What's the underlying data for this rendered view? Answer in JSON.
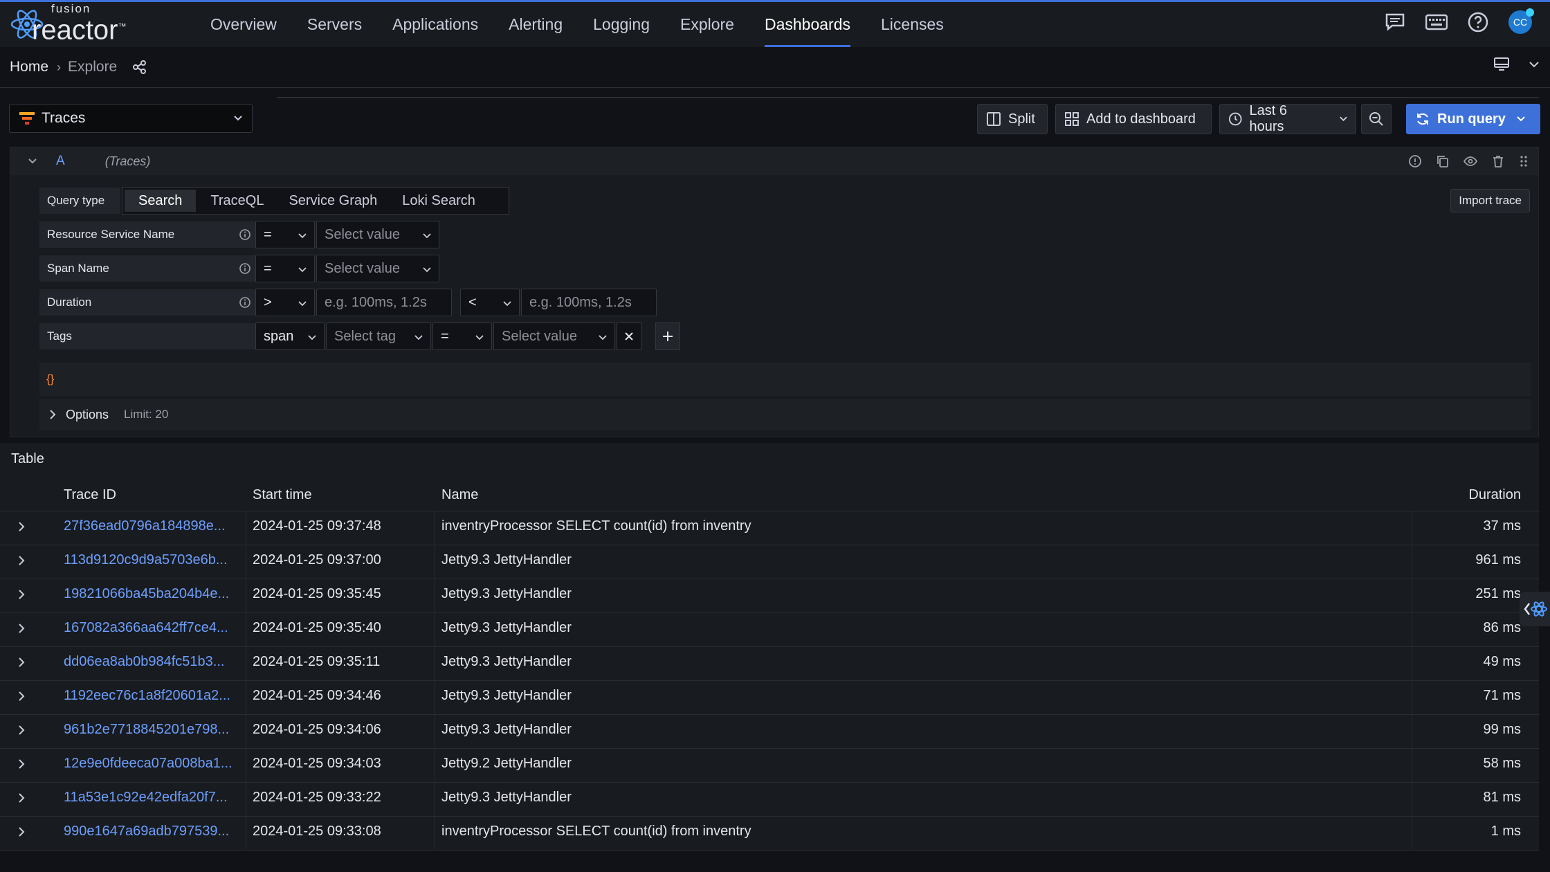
{
  "app": {
    "logo_small": "fusion",
    "logo_big": "reactor",
    "logo_tm": "™"
  },
  "nav": {
    "items": [
      {
        "label": "Overview"
      },
      {
        "label": "Servers"
      },
      {
        "label": "Applications"
      },
      {
        "label": "Alerting"
      },
      {
        "label": "Logging"
      },
      {
        "label": "Explore"
      },
      {
        "label": "Dashboards",
        "active": true
      },
      {
        "label": "Licenses"
      }
    ],
    "icons": [
      "chat-icon",
      "keyboard-icon",
      "help-icon"
    ],
    "avatar_text": "CC"
  },
  "breadcrumb": {
    "home": "Home",
    "current": "Explore"
  },
  "toolbar": {
    "datasource": "Traces",
    "split": "Split",
    "add_to_dashboard": "Add to dashboard",
    "time_range": "Last 6 hours",
    "run_query": "Run query"
  },
  "query": {
    "letter": "A",
    "datasource_label": "(Traces)",
    "query_type_label": "Query type",
    "tabs": [
      "Search",
      "TraceQL",
      "Service Graph",
      "Loki Search"
    ],
    "active_tab": "Search",
    "import_trace": "Import trace",
    "filters": {
      "resource_service_name": {
        "label": "Resource Service Name",
        "operator": "=",
        "value_placeholder": "Select value"
      },
      "span_name": {
        "label": "Span Name",
        "operator": "=",
        "value_placeholder": "Select value"
      },
      "duration": {
        "label": "Duration",
        "op_min": ">",
        "min_placeholder": "e.g. 100ms, 1.2s",
        "op_max": "<",
        "max_placeholder": "e.g. 100ms, 1.2s"
      },
      "tags": {
        "label": "Tags",
        "scope": "span",
        "tag_placeholder": "Select tag",
        "operator": "=",
        "value_placeholder": "Select value"
      }
    },
    "editor_text": "{}",
    "options_label": "Options",
    "options_limit": "Limit: 20"
  },
  "table": {
    "title": "Table",
    "columns": [
      "Trace ID",
      "Start time",
      "Name",
      "Duration"
    ],
    "rows": [
      {
        "trace_id": "27f36ead0796a184898e...",
        "start": "2024-01-25 09:37:48",
        "name": "inventryProcessor SELECT count(id) from inventry",
        "duration": "37 ms"
      },
      {
        "trace_id": "113d9120c9d9a5703e6b...",
        "start": "2024-01-25 09:37:00",
        "name": "Jetty9.3 JettyHandler",
        "duration": "961 ms"
      },
      {
        "trace_id": "19821066ba45ba204b4e...",
        "start": "2024-01-25 09:35:45",
        "name": "Jetty9.3 JettyHandler",
        "duration": "251 ms"
      },
      {
        "trace_id": "167082a366aa642ff7ce4...",
        "start": "2024-01-25 09:35:40",
        "name": "Jetty9.3 JettyHandler",
        "duration": "86 ms"
      },
      {
        "trace_id": "dd06ea8ab0b984fc51b3...",
        "start": "2024-01-25 09:35:11",
        "name": "Jetty9.3 JettyHandler",
        "duration": "49 ms"
      },
      {
        "trace_id": "1192eec76c1a8f20601a2...",
        "start": "2024-01-25 09:34:46",
        "name": "Jetty9.3 JettyHandler",
        "duration": "71 ms"
      },
      {
        "trace_id": "961b2e7718845201e798...",
        "start": "2024-01-25 09:34:06",
        "name": "Jetty9.3 JettyHandler",
        "duration": "99 ms"
      },
      {
        "trace_id": "12e9e0fdeeca07a008ba1...",
        "start": "2024-01-25 09:34:03",
        "name": "Jetty9.2 JettyHandler",
        "duration": "58 ms"
      },
      {
        "trace_id": "11a53e1c92e42edfa20f7...",
        "start": "2024-01-25 09:33:22",
        "name": "Jetty9.3 JettyHandler",
        "duration": "81 ms"
      },
      {
        "trace_id": "990e1647a69adb797539...",
        "start": "2024-01-25 09:33:08",
        "name": "inventryProcessor SELECT count(id) from inventry",
        "duration": "1 ms"
      }
    ]
  },
  "colors": {
    "accent": "#3d71d9",
    "link": "#6e9fff",
    "background": "#111217",
    "panel": "#181b1f"
  }
}
